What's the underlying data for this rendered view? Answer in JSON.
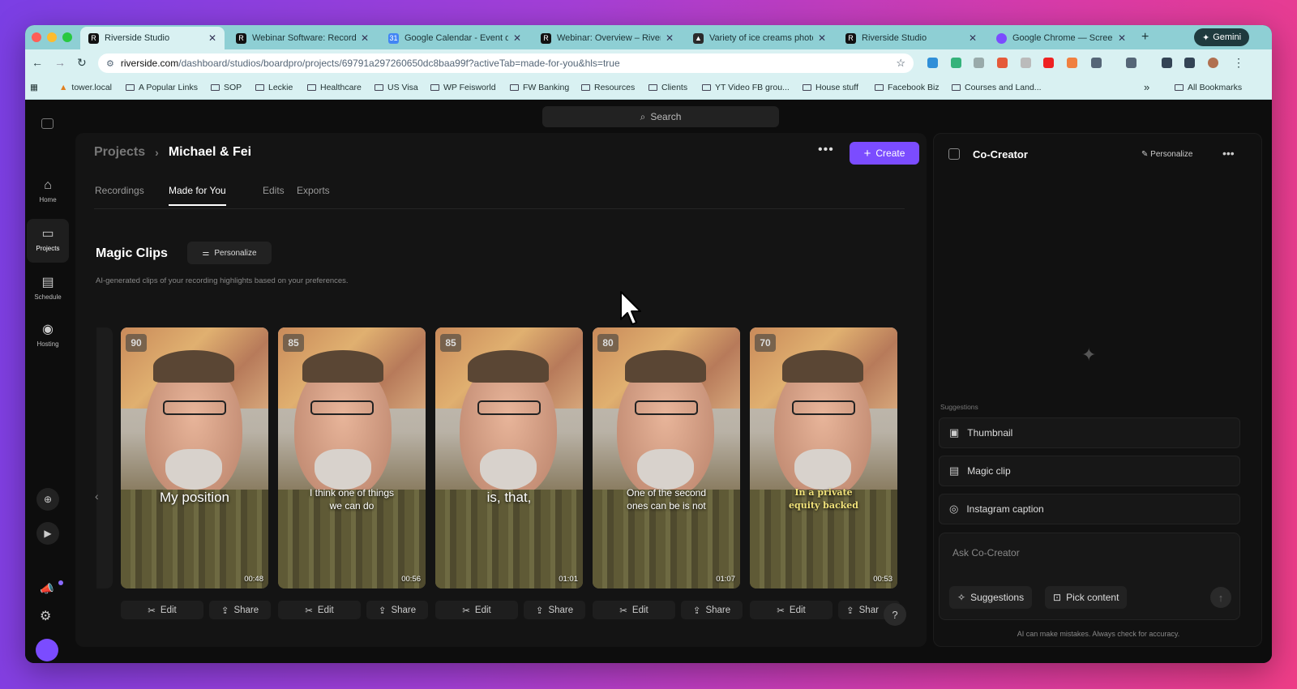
{
  "browser": {
    "tabs": [
      {
        "title": "Riverside Studio",
        "active": true
      },
      {
        "title": "Webinar Software: Record, ",
        "active": false
      },
      {
        "title": "Google Calendar - Event de",
        "active": false
      },
      {
        "title": "Webinar: Overview – Rivers",
        "active": false
      },
      {
        "title": "Variety of ice creams photo",
        "active": false
      },
      {
        "title": "Riverside Studio",
        "active": false
      },
      {
        "title": "Google Chrome — Screen S",
        "active": false
      }
    ],
    "gemini_label": "Gemini",
    "url_domain": "riverside.com",
    "url_path": "/dashboard/studios/boardpro/projects/69791a297260650dc8baa99f?activeTab=made-for-you&hls=true",
    "bookmarks": [
      "tower.local",
      "A Popular Links",
      "SOP",
      "Leckie",
      "Healthcare",
      "US Visa",
      "WP Feisworld",
      "FW Banking",
      "Resources",
      "Clients",
      "YT Video FB grou...",
      "House stuff",
      "Facebook Biz",
      "Courses and Land..."
    ],
    "all_bookmarks": "All Bookmarks",
    "chevron": "»"
  },
  "app": {
    "search_label": "Search",
    "rail": [
      {
        "label": "Home",
        "icon": "home-icon",
        "glyph": "⌂"
      },
      {
        "label": "Projects",
        "icon": "folder-icon",
        "glyph": "▭"
      },
      {
        "label": "Schedule",
        "icon": "calendar-icon",
        "glyph": "▤"
      },
      {
        "label": "Hosting",
        "icon": "podcast-icon",
        "glyph": "◉"
      }
    ],
    "breadcrumb": {
      "root": "Projects",
      "sep": "›",
      "current": "Michael & Fei"
    },
    "create_label": "Create",
    "tabs": [
      "Recordings",
      "Made for You",
      "Edits",
      "Exports"
    ],
    "active_tab": "Made for You",
    "magic_clips": {
      "title": "Magic Clips",
      "personalize": "Personalize",
      "description": "AI-generated clips of your recording highlights based on your preferences.",
      "clips": [
        {
          "score": "90",
          "caption": "My position",
          "duration": "00:48",
          "style": "big"
        },
        {
          "score": "85",
          "caption": "I think one of things we can do",
          "duration": "00:56",
          "style": "normal"
        },
        {
          "score": "85",
          "caption": "is, that,",
          "duration": "01:01",
          "style": "big"
        },
        {
          "score": "80",
          "caption": "One of the second ones can be is not",
          "duration": "01:07",
          "style": "normal"
        },
        {
          "score": "70",
          "caption": "In a private equity backed",
          "duration": "00:53",
          "style": "yellow"
        }
      ],
      "edit_label": "Edit",
      "share_label": "Share",
      "share_label_cut": "Shar"
    },
    "help": "?"
  },
  "cocreator": {
    "title": "Co-Creator",
    "personalize": "Personalize",
    "suggestions_label": "Suggestions",
    "suggestions": [
      {
        "label": "Thumbnail",
        "icon": "thumbnail-icon"
      },
      {
        "label": "Magic clip",
        "icon": "clip-icon"
      },
      {
        "label": "Instagram caption",
        "icon": "instagram-icon"
      }
    ],
    "ask_placeholder": "Ask Co-Creator",
    "suggestions_btn": "Suggestions",
    "pick_content_btn": "Pick content",
    "disclaimer": "AI can make mistakes. Always check for accuracy."
  },
  "colors": {
    "accent": "#7b4cff",
    "tabstrip": "#8ecfd4",
    "toolbar": "#d9f1f2"
  }
}
